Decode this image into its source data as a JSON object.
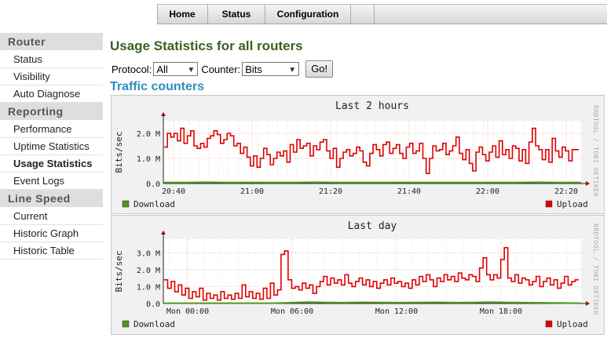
{
  "nav": {
    "items": [
      {
        "label": "Home"
      },
      {
        "label": "Status"
      },
      {
        "label": "Configuration"
      }
    ]
  },
  "sidebar": {
    "sections": [
      {
        "title": "Router",
        "items": [
          "Status",
          "Visibility",
          "Auto Diagnose"
        ]
      },
      {
        "title": "Reporting",
        "items": [
          "Performance",
          "Uptime Statistics",
          "Usage Statistics",
          "Event Logs"
        ]
      },
      {
        "title": "Line Speed",
        "items": [
          "Current",
          "Historic Graph",
          "Historic Table"
        ]
      }
    ],
    "active": "Usage Statistics"
  },
  "page": {
    "title": "Usage Statistics for all routers"
  },
  "form": {
    "protocol_label": "Protocol:",
    "protocol_value": "All",
    "counter_label": "Counter:",
    "counter_value": "Bits",
    "go_label": "Go!"
  },
  "section": {
    "title": "Traffic counters"
  },
  "colors": {
    "download": "#4a9a1a",
    "upload": "#e00000",
    "title_green": "#3d5f1f",
    "title_blue": "#2e8ec0"
  },
  "chart_data": [
    {
      "type": "line",
      "title": "Last 2 hours",
      "ylabel": "Bits/sec",
      "watermark": "RRDTOOL / TOBI OETIKER",
      "yticks": [
        "2.0 M",
        "1.0 M",
        "0.0"
      ],
      "ylim": [
        0,
        2500000
      ],
      "xticks": [
        "20:40",
        "21:00",
        "21:20",
        "21:40",
        "22:00",
        "22:20"
      ],
      "legend": [
        "Download",
        "Upload"
      ],
      "series": [
        {
          "name": "Upload",
          "values": [
            1450000,
            2000000,
            1850000,
            2000000,
            1700000,
            2200000,
            1600000,
            1900000,
            2100000,
            1500000,
            1400000,
            1600000,
            1450000,
            1800000,
            1900000,
            2100000,
            1950000,
            1600000,
            1750000,
            2000000,
            1900000,
            1500000,
            1600000,
            1200000,
            1450000,
            1050000,
            700000,
            1100000,
            650000,
            1000000,
            1400000,
            1150000,
            750000,
            1000000,
            1250000,
            1100000,
            1300000,
            850000,
            1550000,
            1250000,
            1750000,
            1400000,
            1500000,
            1600000,
            1100000,
            1500000,
            1350000,
            1650000,
            1750000,
            1300000,
            1000000,
            1400000,
            650000,
            1000000,
            1250000,
            1350000,
            1100000,
            1200000,
            1450000,
            1300000,
            850000,
            700000,
            1200000,
            1550000,
            1350000,
            1100000,
            1550000,
            1650000,
            1200000,
            1400000,
            1550000,
            1200000,
            1000000,
            1450000,
            1600000,
            1200000,
            1300000,
            1600000,
            1000000,
            400000,
            1000000,
            1500000,
            1300000,
            1350000,
            1600000,
            1150000,
            1300000,
            1500000,
            1850000,
            1200000,
            950000,
            1350000,
            800000,
            500000,
            1250000,
            1450000,
            1150000,
            900000,
            1250000,
            1500000,
            1050000,
            1700000,
            1150000,
            1350000,
            1000000,
            1500000,
            1400000,
            900000,
            1350000,
            800000,
            1650000,
            2200000,
            1500000,
            1350000,
            950000,
            1350000,
            850000,
            1800000,
            1300000,
            1050000,
            1450000,
            1300000,
            900000,
            1350000,
            1350000
          ]
        },
        {
          "name": "Download",
          "values": [
            40000,
            40000,
            50000,
            40000,
            45000,
            40000,
            40000,
            50000,
            40000,
            40000,
            40000,
            45000,
            40000,
            40000,
            40000,
            40000,
            40000,
            50000,
            40000,
            40000
          ]
        }
      ]
    },
    {
      "type": "line",
      "title": "Last day",
      "ylabel": "Bits/sec",
      "watermark": "RRDTOOL / TOBI OETIKER",
      "yticks": [
        "3.0 M",
        "2.0 M",
        "1.0 M",
        "0.0"
      ],
      "ylim": [
        0,
        3800000
      ],
      "xticks": [
        "Mon 00:00",
        "Mon 06:00",
        "Mon 12:00",
        "Mon 18:00"
      ],
      "legend": [
        "Download",
        "Upload"
      ],
      "series": [
        {
          "name": "Upload",
          "values": [
            1400000,
            900000,
            1300000,
            700000,
            1100000,
            500000,
            900000,
            300000,
            700000,
            400000,
            900000,
            200000,
            600000,
            300000,
            500000,
            200000,
            700000,
            300000,
            500000,
            250000,
            600000,
            300000,
            1100000,
            400000,
            700000,
            300000,
            600000,
            250000,
            900000,
            300000,
            1200000,
            500000,
            800000,
            2900000,
            3100000,
            1400000,
            900000,
            1000000,
            800000,
            1200000,
            900000,
            1100000,
            600000,
            1000000,
            1300000,
            1600000,
            1100000,
            1500000,
            1200000,
            1400000,
            1100000,
            1700000,
            1200000,
            1000000,
            1300000,
            1500000,
            1100000,
            1400000,
            1000000,
            1300000,
            900000,
            1200000,
            1400000,
            1100000,
            1500000,
            1200000,
            1300000,
            1000000,
            1200000,
            900000,
            1400000,
            1100000,
            1600000,
            1300000,
            1700000,
            1400000,
            1000000,
            1500000,
            1300000,
            1700000,
            1400000,
            1600000,
            1300000,
            1800000,
            1500000,
            1400000,
            1700000,
            1600000,
            1300000,
            2100000,
            2700000,
            1700000,
            1400000,
            1700000,
            1500000,
            2600000,
            3300000,
            1500000,
            1300000,
            1700000,
            1200000,
            1500000,
            1400000,
            1100000,
            1300000,
            1600000,
            1000000,
            1300000,
            1500000,
            1100000,
            1400000,
            900000,
            1200000,
            1600000,
            1100000,
            1300000,
            1400000
          ]
        },
        {
          "name": "Download",
          "values": [
            20000,
            20000,
            20000,
            20000,
            20000,
            20000,
            20000,
            50000,
            80000,
            60000,
            50000,
            70000,
            60000,
            50000,
            60000,
            70000,
            50000,
            60000,
            80000,
            60000,
            50000,
            40000,
            30000,
            20000
          ]
        }
      ]
    }
  ]
}
